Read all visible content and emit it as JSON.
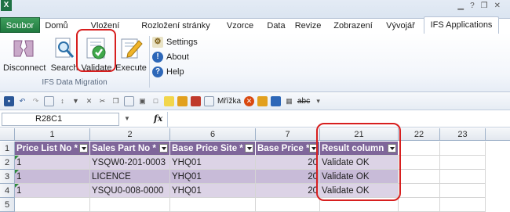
{
  "app_icon": "X",
  "tabs": {
    "file": "Soubor",
    "items": [
      "Domů",
      "Vložení",
      "Rozložení stránky",
      "Vzorce",
      "Data",
      "Revize",
      "Zobrazení",
      "Vývojář"
    ],
    "active": "IFS Applications"
  },
  "window_controls": [
    "minimize-icon",
    "help-icon",
    "restore-icon",
    "close-icon"
  ],
  "ribbon": {
    "buttons": {
      "disconnect": "Disconnect",
      "search": "Search",
      "validate": "Validate",
      "execute": "Execute"
    },
    "group_label": "IFS Data Migration",
    "small_buttons": {
      "settings": "Settings",
      "about": "About",
      "help": "Help"
    }
  },
  "qat": {
    "gridlines_label": "Mřížka"
  },
  "formula_bar": {
    "name_box": "R28C1",
    "fx": "fx",
    "formula": ""
  },
  "grid": {
    "column_headers": [
      "1",
      "2",
      "6",
      "7",
      "21",
      "22",
      "23"
    ],
    "row_headers": [
      "1",
      "2",
      "3",
      "4",
      "5"
    ],
    "headers": [
      "Price List No *",
      "Sales Part No *",
      "Base Price Site *",
      "Base Price *",
      "Result column"
    ],
    "rows": [
      [
        "1",
        "YSQW0-201-0003",
        "YHQ01",
        "20",
        "Validate OK"
      ],
      [
        "1",
        "LICENCE",
        "YHQ01",
        "20",
        "Validate OK"
      ],
      [
        "1",
        "YSQU0-008-0000",
        "YHQ01",
        "20",
        "Validate OK"
      ]
    ]
  },
  "colors": {
    "header_fill": "#7f669a",
    "band_light": "#dcd3e6",
    "band_dark": "#c8bbd8",
    "highlight": "#d71f1f",
    "file_tab": "#217a40"
  }
}
